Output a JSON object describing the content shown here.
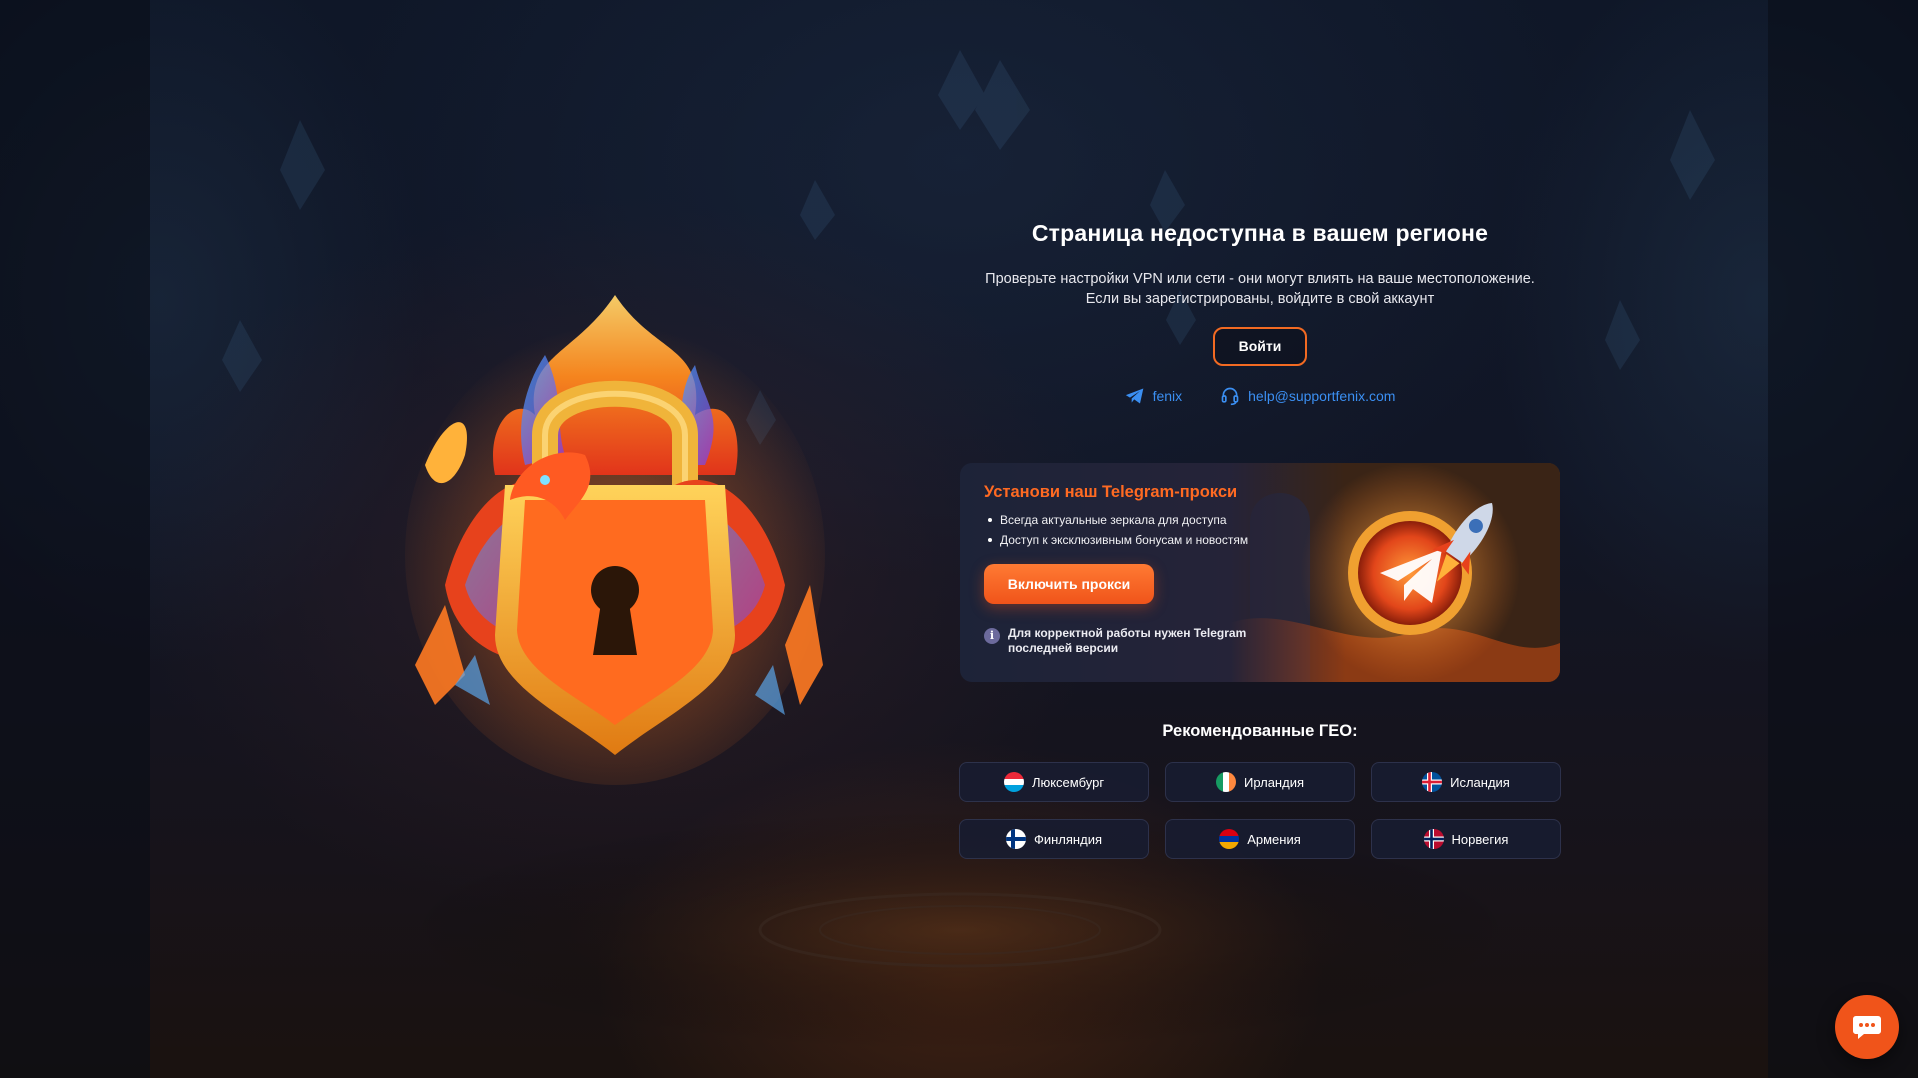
{
  "page": {
    "title": "Страница недоступна в вашем регионе",
    "subtitle_line1": "Проверьте настройки VPN или сети - они могут влиять на ваше местоположение.",
    "subtitle_line2": "Если вы зарегистрированы, войдите в свой аккаунт",
    "login_label": "Войти"
  },
  "contacts": {
    "telegram_label": "fenix",
    "telegram_icon": "telegram-icon",
    "email_label": "help@supportfenix.com",
    "email_icon": "headset-icon"
  },
  "promo": {
    "title": "Установи наш Telegram-прокси",
    "bullets": [
      "Всегда актуальные зеркала для доступа",
      "Доступ к эксклюзивным бонусам и новостям"
    ],
    "button_label": "Включить прокси",
    "note_icon_glyph": "i",
    "note": "Для корректной работы нужен Telegram последней версии"
  },
  "geo": {
    "title": "Рекомендованные ГЕО:",
    "countries": [
      {
        "name": "Люксембург",
        "flag": "luxembourg-flag-icon"
      },
      {
        "name": "Ирландия",
        "flag": "ireland-flag-icon"
      },
      {
        "name": "Исландия",
        "flag": "iceland-flag-icon"
      },
      {
        "name": "Финляндия",
        "flag": "finland-flag-icon"
      },
      {
        "name": "Армения",
        "flag": "armenia-flag-icon"
      },
      {
        "name": "Норвегия",
        "flag": "norway-flag-icon"
      }
    ]
  },
  "chat": {
    "icon": "chat-icon"
  },
  "colors": {
    "accent": "#f26a22",
    "link": "#3b8ff2",
    "promo_title": "#ff6a22",
    "background": "#111626"
  }
}
